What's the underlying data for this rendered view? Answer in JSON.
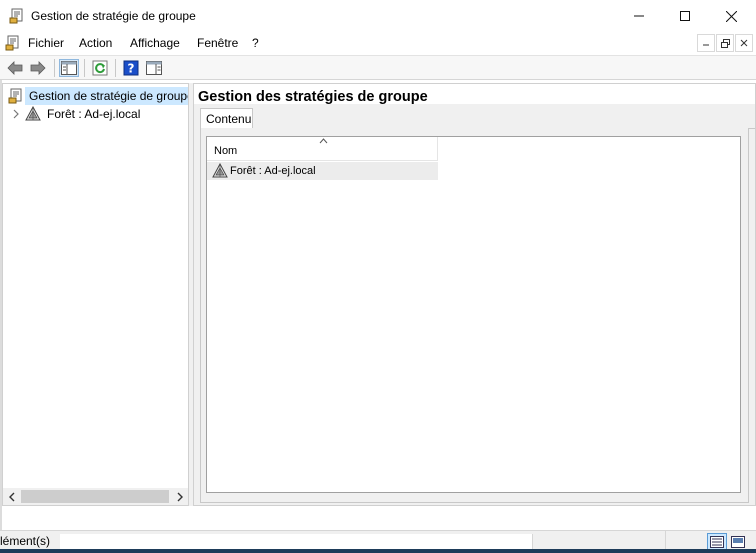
{
  "window": {
    "title": "Gestion de stratégie de groupe",
    "icons": {
      "app": "gpmc-console-icon"
    }
  },
  "menu": {
    "items": [
      "Fichier",
      "Action",
      "Affichage",
      "Fenêtre",
      "?"
    ]
  },
  "toolbar": {
    "buttons": [
      "back-arrow-icon",
      "forward-arrow-icon",
      "show-hide-tree-icon",
      "refresh-icon",
      "help-icon",
      "action-pane-icon"
    ]
  },
  "tree": {
    "root_label": "Gestion de stratégie de groupe",
    "forest_label": "Forêt : Ad-ej.local"
  },
  "content": {
    "title": "Gestion des stratégies de groupe",
    "tab_label": "Contenu",
    "column_nom": "Nom",
    "sort_indicator": "^",
    "rows": [
      {
        "name": "Forêt : Ad-ej.local"
      }
    ]
  },
  "statusbar": {
    "text": "lément(s)"
  },
  "colors": {
    "selection": "#cce8ff",
    "row_highlight": "#ececec",
    "help_blue": "#1a4ec9",
    "refresh_green": "#2e9c3a"
  }
}
